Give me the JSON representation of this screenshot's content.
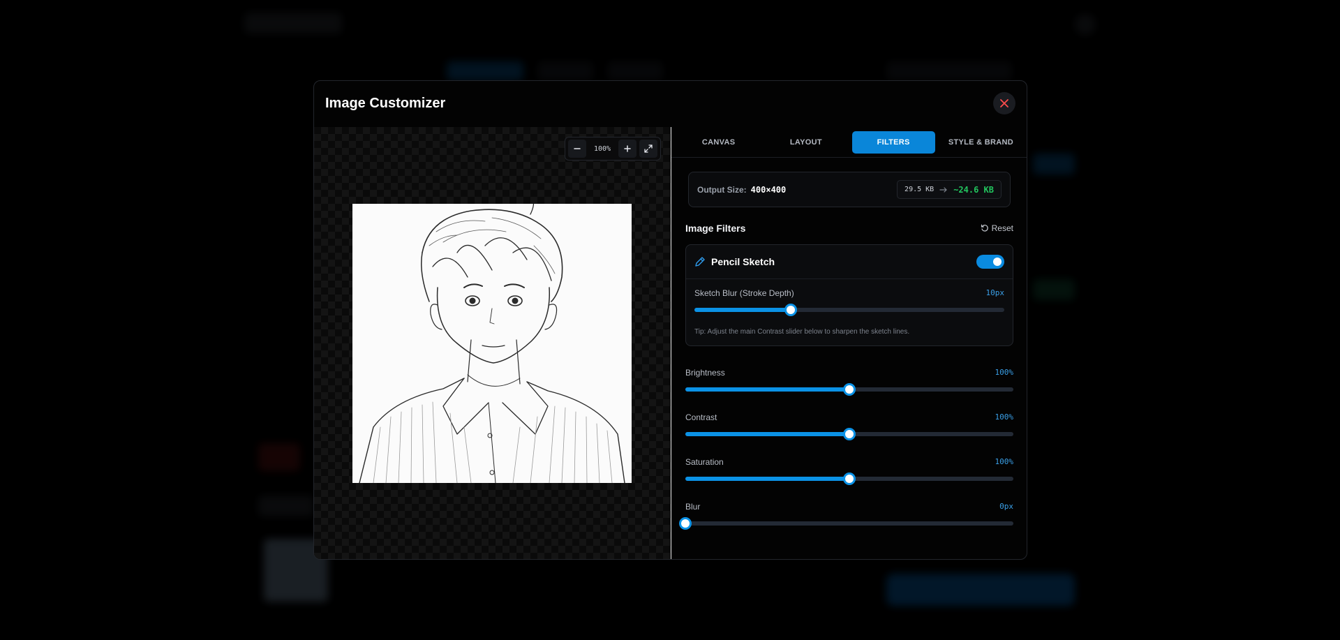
{
  "modal": {
    "title": "Image Customizer",
    "close_icon": "close-icon"
  },
  "preview": {
    "zoom_level": "100%",
    "icons": {
      "zoom_out": "minus-icon",
      "zoom_in": "plus-icon",
      "fullscreen": "expand-icon"
    }
  },
  "tabs": [
    {
      "label": "CANVAS",
      "active": false
    },
    {
      "label": "LAYOUT",
      "active": false
    },
    {
      "label": "FILTERS",
      "active": true
    },
    {
      "label": "STYLE & BRAND",
      "active": false
    }
  ],
  "output": {
    "label": "Output Size:",
    "dimensions": "400×400",
    "original_size": "29.5 KB",
    "new_size": "~24.6 KB"
  },
  "filters": {
    "title": "Image Filters",
    "reset_label": "Reset",
    "pencil_sketch": {
      "title": "Pencil Sketch",
      "enabled": true,
      "blur_label": "Sketch Blur (Stroke Depth)",
      "blur_value": "10px",
      "blur_fraction": 0.31,
      "tip": "Tip: Adjust the main Contrast slider below to sharpen the sketch lines."
    },
    "sliders": [
      {
        "label": "Brightness",
        "value": "100%",
        "fraction": 0.5
      },
      {
        "label": "Contrast",
        "value": "100%",
        "fraction": 0.5
      },
      {
        "label": "Saturation",
        "value": "100%",
        "fraction": 0.5
      },
      {
        "label": "Blur",
        "value": "0px",
        "fraction": 0.0
      }
    ]
  },
  "colors": {
    "accent": "#0a86d9",
    "success": "#22c55e",
    "close": "#ff4d4d"
  }
}
